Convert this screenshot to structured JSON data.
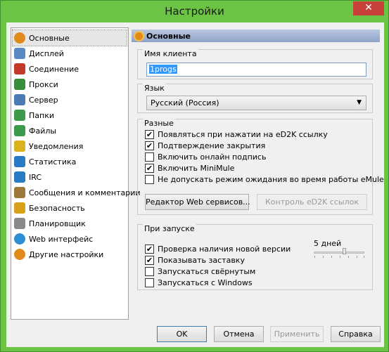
{
  "window": {
    "title": "Настройки",
    "close_glyph": "✕"
  },
  "nav": {
    "items": [
      {
        "label": "Основные",
        "icon": "gear-icon",
        "color": "#e08a1c"
      },
      {
        "label": "Дисплей",
        "icon": "monitor-icon",
        "color": "#5a8ac6"
      },
      {
        "label": "Соединение",
        "icon": "plug-icon",
        "color": "#c43a2a"
      },
      {
        "label": "Прокси",
        "icon": "proxy-icon",
        "color": "#3b8c3b"
      },
      {
        "label": "Сервер",
        "icon": "server-icon",
        "color": "#4b7bb5"
      },
      {
        "label": "Папки",
        "icon": "folder-icon",
        "color": "#3d9a4a"
      },
      {
        "label": "Файлы",
        "icon": "files-icon",
        "color": "#3d9a4a"
      },
      {
        "label": "Уведомления",
        "icon": "notification-icon",
        "color": "#d9b21c"
      },
      {
        "label": "Статистика",
        "icon": "statistics-icon",
        "color": "#2a7bc4"
      },
      {
        "label": "IRC",
        "icon": "irc-icon",
        "color": "#2a7bc4"
      },
      {
        "label": "Сообщения и комментарии",
        "icon": "messages-icon",
        "color": "#9e7a3a"
      },
      {
        "label": "Безопасность",
        "icon": "lock-icon",
        "color": "#d9a01c"
      },
      {
        "label": "Планировщик",
        "icon": "scheduler-icon",
        "color": "#8a8a8a"
      },
      {
        "label": "Web интерфейс",
        "icon": "globe-icon",
        "color": "#2f8fd3"
      },
      {
        "label": "Другие настройки",
        "icon": "other-settings-icon",
        "color": "#e08a1c"
      }
    ]
  },
  "panel": {
    "header": "Основные",
    "client_name": {
      "label": "Имя клиента",
      "value": "1progs"
    },
    "language": {
      "label": "Язык",
      "selected": "Русский (Россия)"
    },
    "misc": {
      "label": "Разные",
      "checkboxes": [
        {
          "label": "Появляться при нажатии на eD2K ссылку",
          "checked": "✔"
        },
        {
          "label": "Подтверждение закрытия",
          "checked": "✔"
        },
        {
          "label": "Включить онлайн подпись",
          "checked": ""
        },
        {
          "label": "Включить MiniMule",
          "checked": "✔"
        },
        {
          "label": "Не допускать режим ожидания во время работы eMule",
          "checked": ""
        }
      ],
      "web_services_button": "Редактор Web сервисов...",
      "ed2k_links_button": "Контроль eD2K ссылок"
    },
    "startup": {
      "label": "При запуске",
      "slider_label": "5 дней",
      "slider_value_fraction": 0.6,
      "checkboxes": [
        {
          "label": "Проверка наличия новой версии",
          "checked": "✔"
        },
        {
          "label": "Показывать заставку",
          "checked": "✔"
        },
        {
          "label": "Запускаться свёрнутым",
          "checked": ""
        },
        {
          "label": "Запускаться с Windows",
          "checked": ""
        }
      ]
    }
  },
  "buttons": {
    "ok": "OK",
    "cancel": "Отмена",
    "apply": "Применить",
    "help": "Справка"
  }
}
